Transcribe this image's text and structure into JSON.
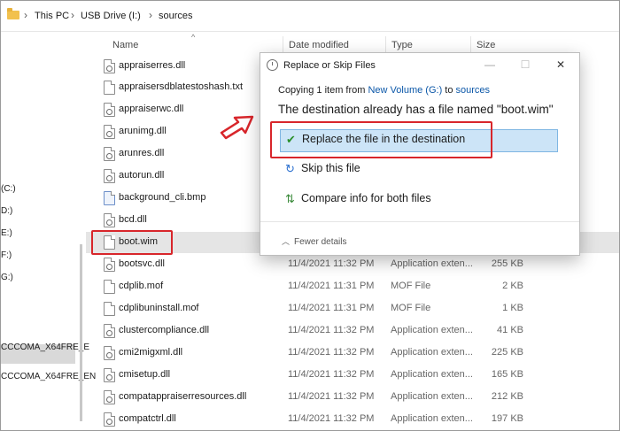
{
  "breadcrumb": {
    "items": [
      "This PC",
      "USB Drive (I:)",
      "sources"
    ],
    "separator": "›"
  },
  "columns": {
    "name": "Name",
    "date": "Date modified",
    "type": "Type",
    "size": "Size",
    "sort_glyph": "^"
  },
  "nav": {
    "items": [
      "(C:)",
      "D:)",
      "E:)",
      "F:)",
      "G:)",
      "CCCOMA_X64FRE_E",
      "CCCOMA_X64FRE_EN"
    ]
  },
  "files": [
    {
      "name": "appraiserres.dll",
      "date": "",
      "type": "",
      "size": "",
      "icon": "dll-file-icon"
    },
    {
      "name": "appraisersdblatestoshash.txt",
      "date": "",
      "type": "",
      "size": "",
      "icon": "text-file-icon"
    },
    {
      "name": "appraiserwc.dll",
      "date": "",
      "type": "",
      "size": "",
      "icon": "dll-file-icon"
    },
    {
      "name": "arunimg.dll",
      "date": "",
      "type": "",
      "size": "",
      "icon": "dll-file-icon"
    },
    {
      "name": "arunres.dll",
      "date": "",
      "type": "",
      "size": "",
      "icon": "dll-file-icon"
    },
    {
      "name": "autorun.dll",
      "date": "",
      "type": "",
      "size": "",
      "icon": "dll-file-icon"
    },
    {
      "name": "background_cli.bmp",
      "date": "",
      "type": "",
      "size": "",
      "icon": "bitmap-file-icon"
    },
    {
      "name": "bcd.dll",
      "date": "",
      "type": "",
      "size": "",
      "icon": "dll-file-icon"
    },
    {
      "name": "boot.wim",
      "date": "",
      "type": "",
      "size": "",
      "icon": "wim-file-icon"
    },
    {
      "name": "bootsvc.dll",
      "date": "11/4/2021 11:32 PM",
      "type": "Application exten...",
      "size": "255 KB",
      "icon": "dll-file-icon"
    },
    {
      "name": "cdplib.mof",
      "date": "11/4/2021 11:31 PM",
      "type": "MOF File",
      "size": "2 KB",
      "icon": "mof-file-icon"
    },
    {
      "name": "cdplibuninstall.mof",
      "date": "11/4/2021 11:31 PM",
      "type": "MOF File",
      "size": "1 KB",
      "icon": "mof-file-icon"
    },
    {
      "name": "clustercompliance.dll",
      "date": "11/4/2021 11:32 PM",
      "type": "Application exten...",
      "size": "41 KB",
      "icon": "dll-file-icon"
    },
    {
      "name": "cmi2migxml.dll",
      "date": "11/4/2021 11:32 PM",
      "type": "Application exten...",
      "size": "225 KB",
      "icon": "dll-file-icon"
    },
    {
      "name": "cmisetup.dll",
      "date": "11/4/2021 11:32 PM",
      "type": "Application exten...",
      "size": "165 KB",
      "icon": "dll-file-icon"
    },
    {
      "name": "compatappraiserresources.dll",
      "date": "11/4/2021 11:32 PM",
      "type": "Application exten...",
      "size": "212 KB",
      "icon": "dll-file-icon"
    },
    {
      "name": "compatctrl.dll",
      "date": "11/4/2021 11:32 PM",
      "type": "Application exten...",
      "size": "197 KB",
      "icon": "dll-file-icon"
    }
  ],
  "dialog": {
    "title": "Replace or Skip Files",
    "window_buttons": {
      "minimize": "—",
      "maximize": "☐",
      "close": "✕"
    },
    "copying_prefix": "Copying 1 item from ",
    "source_link": "New Volume (G:)",
    "copying_mid": " to ",
    "dest_link": "sources",
    "message": "The destination already has a file named \"boot.wim\"",
    "options": {
      "replace": {
        "glyph": "✔",
        "label": "Replace the file in the destination"
      },
      "skip": {
        "glyph": "↻",
        "label": "Skip this file"
      },
      "compare": {
        "glyph": "⇅",
        "label": "Compare info for both files"
      }
    },
    "fewer_details": {
      "glyph": "︿",
      "label": "Fewer details"
    }
  },
  "colors": {
    "highlight": "#d8262b",
    "accent": "#cce4f7",
    "link": "#0b57a8"
  }
}
